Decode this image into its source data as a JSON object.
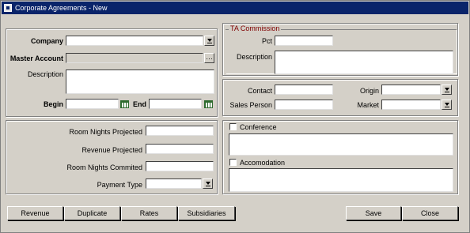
{
  "window": {
    "title": "Corporate Agreements - New"
  },
  "general": {
    "company_label": "Company",
    "company_value": "",
    "master_account_label": "Master Account",
    "master_account_value": "",
    "description_label": "Description",
    "description_value": "",
    "begin_label": "Begin",
    "begin_value": "",
    "end_label": "End",
    "end_value": ""
  },
  "ta_commission": {
    "legend": "TA Commission",
    "pct_label": "Pct",
    "pct_value": "",
    "description_label": "Description",
    "description_value": ""
  },
  "contact_panel": {
    "contact_label": "Contact",
    "contact_value": "",
    "sales_person_label": "Sales Person",
    "sales_person_value": "",
    "origin_label": "Origin",
    "origin_value": "",
    "market_label": "Market",
    "market_value": ""
  },
  "projections": {
    "room_nights_projected_label": "Room Nights Projected",
    "room_nights_projected_value": "",
    "revenue_projected_label": "Revenue Projected",
    "revenue_projected_value": "",
    "room_nights_commited_label": "Room Nights Commited",
    "room_nights_commited_value": "",
    "payment_type_label": "Payment Type",
    "payment_type_value": ""
  },
  "options": {
    "conference_label": "Conference",
    "conference_checked": false,
    "conference_text": "",
    "accomodation_label": "Accomodation",
    "accomodation_checked": false,
    "accomodation_text": ""
  },
  "buttons": {
    "revenue": "Revenue",
    "duplicate": "Duplicate",
    "rates": "Rates",
    "subsidiaries": "Subsidiaries",
    "save": "Save",
    "close": "Close"
  },
  "icons": {
    "dropdown": "dropdown-arrow-icon",
    "ellipsis": "ellipsis-icon",
    "calendar": "calendar-icon"
  },
  "colors": {
    "titlebar": "#0a246a",
    "window_bg": "#d4d0c8",
    "legend_text": "#800000"
  }
}
